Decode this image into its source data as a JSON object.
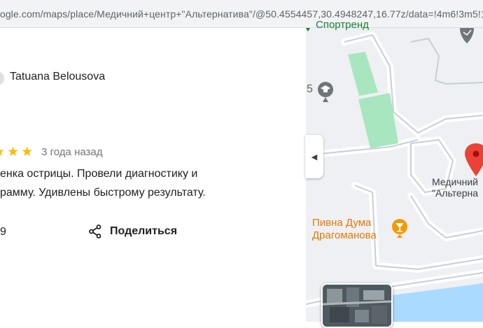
{
  "browser": {
    "url": "ogle.com/maps/place/Медичний+центр+\"Альтернатива\"/@50.4554457,30.4948247,16.77z/data=!4m6!3m5!1s0"
  },
  "review": {
    "reviewer_name": "Tatuana Belousova",
    "rating": 5,
    "stars": [
      "★",
      "★",
      "★"
    ],
    "date": "3 года назад",
    "text_lines": [
      "енка острицы. Провели диагностику и",
      "рамму. Удивлены быстрому результату."
    ],
    "likes_count": "9",
    "share_label": "Поделиться"
  },
  "map": {
    "labels": {
      "sport": "Спортренд",
      "medical_line1": "Медичний",
      "medical_line2": "\"Альтерна",
      "pub_line1": "Пивна Дума",
      "pub_line2": "Драгоманова",
      "number": "5"
    },
    "icons": [
      "school-icon",
      "map-pin-icon",
      "bar-icon",
      "place-marker-icon"
    ],
    "colors": {
      "pin": "#ea4335",
      "park": "#a8e6c0",
      "road": "#c6ced8",
      "water": "#aadaff",
      "pub": "#f29900"
    }
  }
}
